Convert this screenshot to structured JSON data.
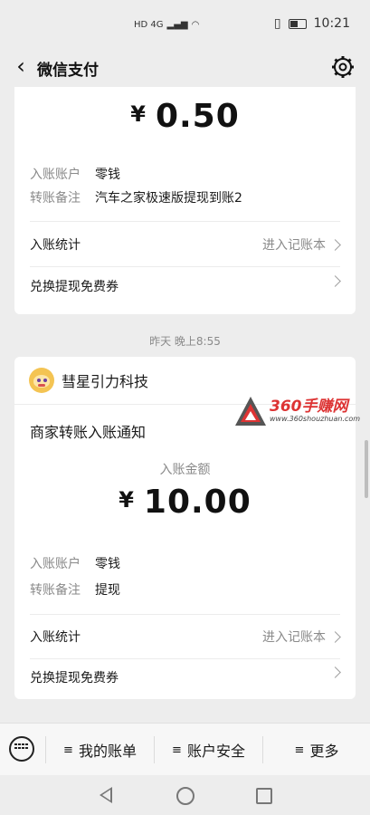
{
  "status": {
    "network": "HD 4G",
    "time": "10:21"
  },
  "header": {
    "title": "微信支付"
  },
  "cards": [
    {
      "amount_currency": "¥",
      "amount": "0.50",
      "rows": [
        {
          "key": "入账账户",
          "value": "零钱"
        },
        {
          "key": "转账备注",
          "value": "汽车之家极速版提现到账2"
        }
      ],
      "stats_label": "入账统计",
      "stats_link": "进入记账本",
      "coupon_label": "兑换提现免费券"
    },
    {
      "timestamp": "昨天 晚上8:55",
      "merchant": "彗星引力科技",
      "subtitle": "商家转账入账通知",
      "amount_label": "入账金额",
      "amount_currency": "¥",
      "amount": "10.00",
      "rows": [
        {
          "key": "入账账户",
          "value": "零钱"
        },
        {
          "key": "转账备注",
          "value": "提现"
        }
      ],
      "stats_label": "入账统计",
      "stats_link": "进入记账本",
      "coupon_label": "兑换提现免费券"
    }
  ],
  "watermark": {
    "text": "360手赚网",
    "url": "www.360shouzhuan.com"
  },
  "bottom_tabs": [
    {
      "label": "我的账单"
    },
    {
      "label": "账户安全"
    },
    {
      "label": "更多"
    }
  ]
}
